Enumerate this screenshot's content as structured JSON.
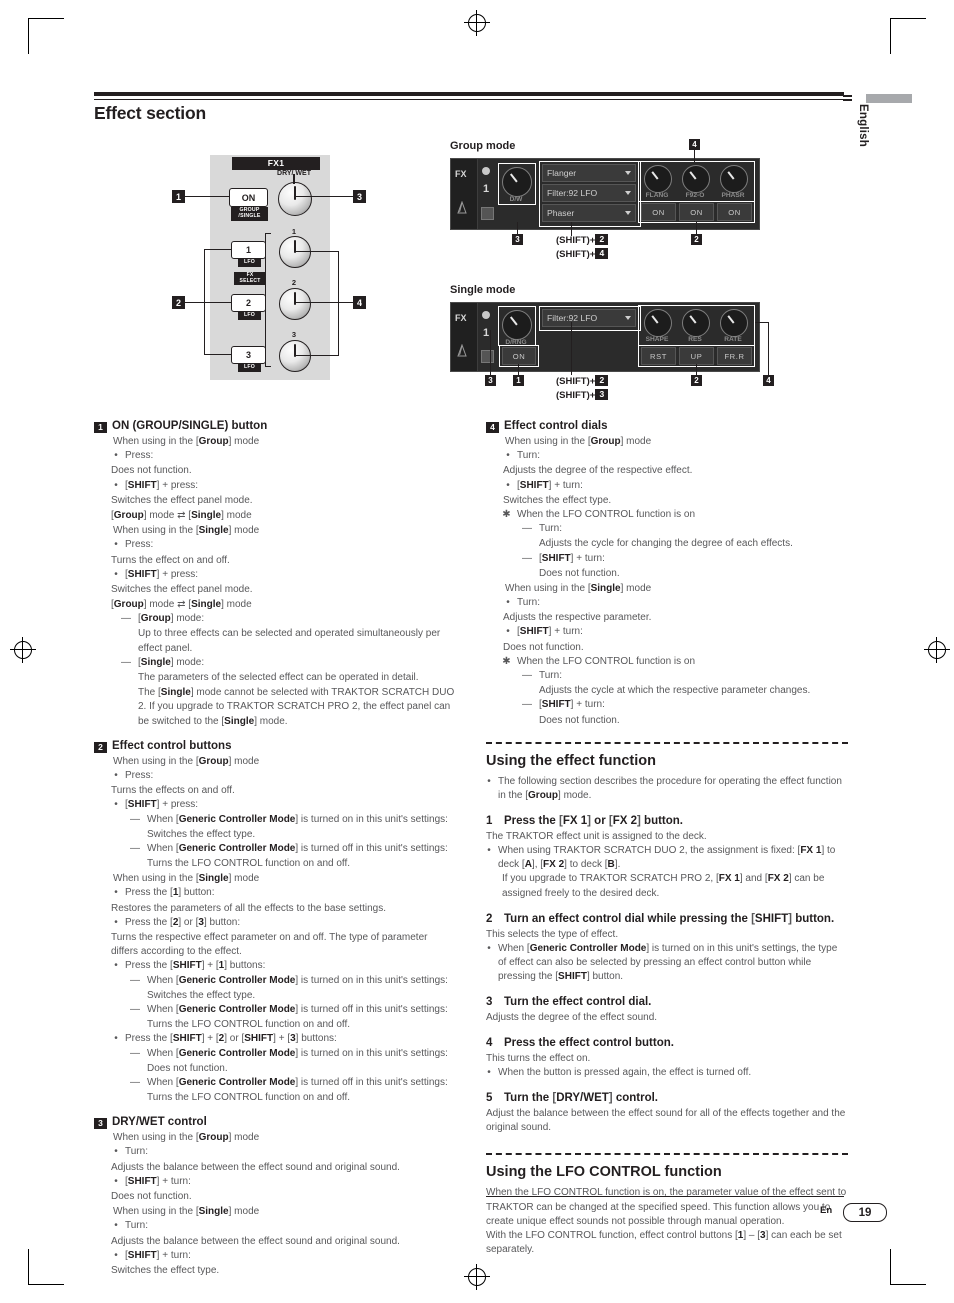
{
  "page": {
    "section_title": "Effect section",
    "language_tab": "English",
    "footer_lang": "En",
    "footer_page": "19"
  },
  "hw_diagram": {
    "fx_label": "FX1",
    "dry_wet_label": "DRY/ WET",
    "on_button": "ON",
    "on_tag_line1": "GROUP",
    "on_tag_line2": "/SINGLE",
    "btn1": "1",
    "btn2": "2",
    "btn3": "3",
    "lfo_tag": "LFO",
    "select_tag": "FX SELECT",
    "knob1": "1",
    "knob2": "2",
    "knob3": "3",
    "callouts": {
      "one": "1",
      "two": "2",
      "three": "3",
      "four": "4"
    }
  },
  "group_mode": {
    "title": "Group mode",
    "fx_label": "FX",
    "deck_number": "1",
    "dw_label": "D/W",
    "effects": [
      "Flanger",
      "Filter:92 LFO",
      "Phaser"
    ],
    "knob_labels": [
      "FLANG",
      "F92-O",
      "PHASR"
    ],
    "buttons": [
      "ON",
      "ON",
      "ON"
    ],
    "shift_note_1": "(SHIFT)+",
    "shift_note_1_num": "2",
    "shift_note_2": "(SHIFT)+",
    "shift_note_2_num": "4",
    "callouts": {
      "two": "2",
      "three": "3",
      "four": "4"
    }
  },
  "single_mode": {
    "title": "Single mode",
    "fx_label": "FX",
    "deck_number": "1",
    "dw_label": "D/RNG",
    "on_button": "ON",
    "effect": "Filter:92 LFO",
    "knob_labels": [
      "SHAPE",
      "RES",
      "RATE"
    ],
    "buttons": [
      "RST",
      "UP",
      "FR.R"
    ],
    "shift_note_1": "(SHIFT)+",
    "shift_note_1_num": "2",
    "shift_note_2": "(SHIFT)+",
    "shift_note_2_num": "3",
    "callouts": {
      "one": "1",
      "two": "2",
      "three": "3",
      "four": "4"
    }
  },
  "item1": {
    "num": "1",
    "title": "ON (GROUP/SINGLE) button",
    "group_head": "When using in the [Group] mode",
    "b1": "Press:",
    "b1_sub": "Does not function.",
    "b2": "[SHIFT] + press:",
    "b2_sub1": "Switches the effect panel mode.",
    "b2_sub2": "[Group] mode ⇄ [Single] mode",
    "single_head": "When using in the [Single] mode",
    "b3": "Press:",
    "b3_sub": "Turns the effect on and off.",
    "b4": "[SHIFT] + press:",
    "b4_sub1": "Switches the effect panel mode.",
    "b4_sub2": "[Group] mode ⇄ [Single] mode",
    "d1": "[Group] mode:",
    "d1_sub": "Up to three effects can be selected and operated simultaneously per effect panel.",
    "d2": "[Single] mode:",
    "d2_sub1": "The parameters of the selected effect can be operated in detail.",
    "d2_sub2": "The [Single] mode cannot be selected with TRAKTOR SCRATCH DUO 2. If you upgrade to TRAKTOR SCRATCH PRO 2, the effect panel can be switched to the [Single] mode."
  },
  "item2": {
    "num": "2",
    "title": "Effect control buttons",
    "group_head": "When using in the [Group] mode",
    "b1": "Press:",
    "b1_sub": "Turns the effects on and off.",
    "b2": "[SHIFT] + press:",
    "b2_d1": "When [Generic Controller Mode] is turned on in this unit's settings:",
    "b2_d1_sub": "Switches the effect type.",
    "b2_d2": "When [Generic Controller Mode] is turned off in this unit's settings:",
    "b2_d2_sub": "Turns the LFO CONTROL function on and off.",
    "single_head": "When using in the [Single] mode",
    "b3": "Press the [1] button:",
    "b3_sub": "Restores the parameters of all the effects to the base settings.",
    "b4": "Press the [2] or [3] button:",
    "b4_sub": "Turns the respective effect parameter on and off. The type of parameter differs according to the effect.",
    "b5": "Press the [SHIFT] + [1] buttons:",
    "b5_d1": "When [Generic Controller Mode] is turned on in this unit's settings:",
    "b5_d1_sub": "Switches the effect type.",
    "b5_d2": "When [Generic Controller Mode] is turned off in this unit's settings:",
    "b5_d2_sub": "Turns the LFO CONTROL function on and off.",
    "b6": "Press the [SHIFT] + [2] or [SHIFT] + [3] buttons:",
    "b6_d1": "When [Generic Controller Mode] is turned on in this unit's settings:",
    "b6_d1_sub": "Does not function.",
    "b6_d2": "When [Generic Controller Mode] is turned off in this unit's settings:",
    "b6_d2_sub": "Turns the LFO CONTROL function on and off."
  },
  "item3": {
    "num": "3",
    "title": "DRY/WET control",
    "group_head": "When using in the [Group] mode",
    "b1": "Turn:",
    "b1_sub": "Adjusts the balance between the effect sound and original sound.",
    "b2": "[SHIFT] + turn:",
    "b2_sub": "Does not function.",
    "single_head": "When using in the [Single] mode",
    "b3": "Turn:",
    "b3_sub": "Adjusts the balance between the effect sound and original sound.",
    "b4": "[SHIFT] + turn:",
    "b4_sub": "Switches the effect type."
  },
  "item4": {
    "num": "4",
    "title": "Effect control dials",
    "group_head": "When using in the [Group] mode",
    "b1": "Turn:",
    "b1_sub": "Adjusts the degree of the respective effect.",
    "b2": "[SHIFT] + turn:",
    "b2_sub": "Switches the effect type.",
    "ast1": "When the LFO CONTROL function is on",
    "ast1_d1": "Turn:",
    "ast1_d1_sub": "Adjusts the cycle for changing the degree of each effects.",
    "ast1_d2": "[SHIFT] + turn:",
    "ast1_d2_sub": "Does not function.",
    "single_head": "When using in the [Single] mode",
    "b3": "Turn:",
    "b3_sub": "Adjusts the respective parameter.",
    "b4": "[SHIFT] + turn:",
    "b4_sub": "Does not function.",
    "ast2": "When the LFO CONTROL function is on",
    "ast2_d1": "Turn:",
    "ast2_d1_sub": "Adjusts the cycle at which the respective parameter changes.",
    "ast2_d2": "[SHIFT] + turn:",
    "ast2_d2_sub": "Does not function."
  },
  "using_effect": {
    "title": "Using the effect function",
    "bullet": "The following section describes the procedure for operating the effect function in the [Group] mode.",
    "steps": [
      {
        "n": "1",
        "title": "Press the [FX 1] or [FX 2] button.",
        "body": "The TRAKTOR effect unit is assigned to the deck.",
        "bullet1": "When using TRAKTOR SCRATCH DUO 2, the assignment is fixed: [FX 1] to deck [A], [FX 2] to deck [B].",
        "bullet1b": "If you upgrade to TRAKTOR SCRATCH PRO 2, [FX 1] and [FX 2] can be assigned freely to the desired deck."
      },
      {
        "n": "2",
        "title": "Turn an effect control dial while pressing the [SHIFT] button.",
        "body": "This selects the type of effect.",
        "bullet1": "When [Generic Controller Mode] is turned on in this unit's settings, the type of effect can also be selected by pressing an effect control button while pressing the [SHIFT] button."
      },
      {
        "n": "3",
        "title": "Turn the effect control dial.",
        "body": "Adjusts the degree of the effect sound."
      },
      {
        "n": "4",
        "title": "Press the effect control button.",
        "body": "This turns the effect on.",
        "bullet1": "When the button is pressed again, the effect is turned off."
      },
      {
        "n": "5",
        "title": "Turn the [DRY/WET] control.",
        "body": "Adjust the balance between the effect sound for all of the effects together and the original sound."
      }
    ]
  },
  "using_lfo": {
    "title": "Using the LFO CONTROL function",
    "p1": "When the LFO CONTROL function is on, the parameter value of the effect sent to TRAKTOR can be changed at the specified speed. This function allows you to create unique effect sounds not possible through manual operation.",
    "p2": "With the LFO CONTROL function, effect control buttons [1] – [3] can each be set separately."
  }
}
